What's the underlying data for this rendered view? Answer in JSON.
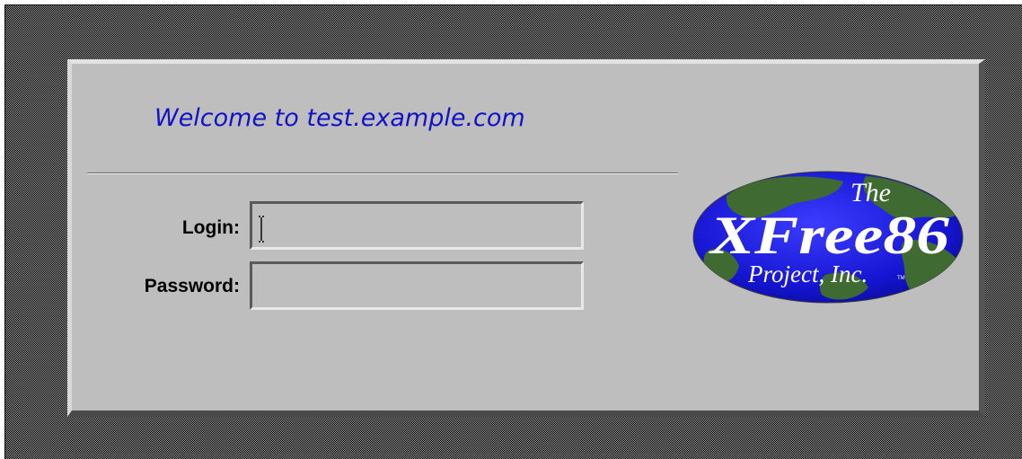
{
  "window": {
    "greeting": "Welcome to test.example.com"
  },
  "form": {
    "login_label": "Login:",
    "login_value": "",
    "password_label": "Password:",
    "password_value": ""
  },
  "logo": {
    "line1": "The",
    "line2": "XFree86",
    "line3": "Project, Inc.",
    "tm": "TM"
  },
  "colors": {
    "panel_background": "#bebebe",
    "greeting_text": "#1212c8",
    "logo_globe": "#1818c8",
    "logo_land": "#3e6a32",
    "desktop_stipple": "#9a9a9a"
  },
  "icons": {
    "text_cursor": "i-beam-cursor-icon",
    "logo": "xfree86-globe-logo"
  }
}
